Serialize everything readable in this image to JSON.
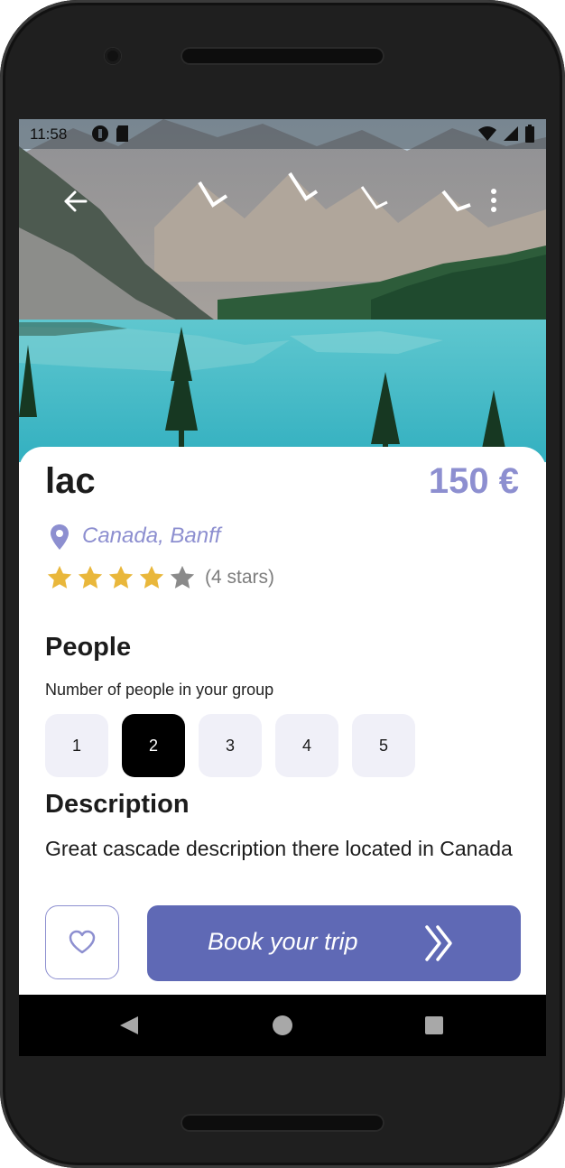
{
  "status_bar": {
    "time": "11:58"
  },
  "place": {
    "name": "lac",
    "price": "150 €",
    "location": "Canada, Banff",
    "rating": 4,
    "rating_max": 5,
    "rating_label": "(4 stars)"
  },
  "people": {
    "heading": "People",
    "subtitle": "Number of people in your group",
    "options": [
      "1",
      "2",
      "3",
      "4",
      "5"
    ],
    "selected": "2"
  },
  "description": {
    "heading": "Description",
    "text": "Great cascade description there located in Canada"
  },
  "actions": {
    "book_label": "Book your trip"
  },
  "colors": {
    "accent": "#8d8fd0",
    "button": "#5f69b5",
    "star_filled": "#e9b73b",
    "star_empty": "#8a8a8a"
  },
  "icons": {
    "back": "arrow-left-icon",
    "more": "more-vertical-icon",
    "location": "location-pin-icon",
    "favorite": "heart-outline-icon",
    "book": "double-chevron-right-icon"
  }
}
